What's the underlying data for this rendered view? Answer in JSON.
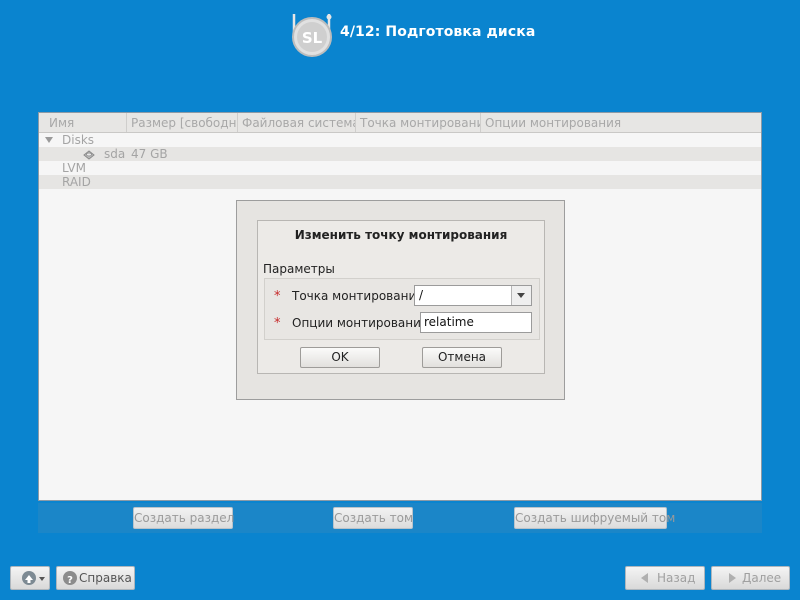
{
  "header": {
    "logo_text": "SL",
    "step_title": "4/12: Подготовка диска"
  },
  "table": {
    "columns": [
      "Имя",
      "Размер [свободно]",
      "Файловая система",
      "Точка монтирования",
      "Опции монтирования"
    ],
    "groups": {
      "disks": "Disks",
      "disk_name": "sda",
      "disk_size": "47 GB",
      "lvm": "LVM",
      "raid": "RAID"
    }
  },
  "dialog": {
    "title": "Изменить точку монтирования",
    "section_label": "Параметры",
    "required_marker": "*",
    "mount_point_label": "Точка монтирования",
    "mount_point_value": "/",
    "mount_options_label": "Опции монтирования",
    "mount_options_value": "relatime",
    "ok_label": "OK",
    "cancel_label": "Отмена"
  },
  "actions": {
    "create_partition": "Создать раздел",
    "create_volume": "Создать том",
    "create_encrypted_volume": "Создать шифруемый том"
  },
  "footer": {
    "help_label": "Справка",
    "back_label": "Назад",
    "next_label": "Далее"
  },
  "colors": {
    "background": "#0a84cf",
    "required_marker": "#c62828"
  }
}
